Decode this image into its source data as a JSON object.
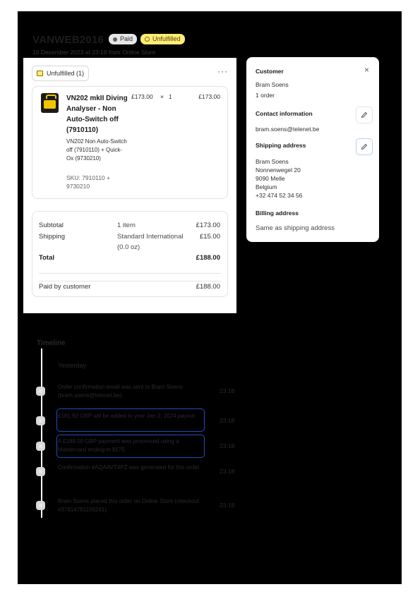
{
  "order": {
    "title": "VANWEB2016",
    "paid_label": "Paid",
    "unfulfilled_label": "Unfulfilled",
    "date_line": "10 December 2023 at 23:18 from Online Store"
  },
  "fulfillment": {
    "status_label": "Unfulfilled (1)",
    "more_label": "···",
    "item": {
      "name": "VN202 mkII Diving Analyser - Non Auto-Switch off (7910110)",
      "variant": "VN202 Non Auto-Switch off (7910110) + Quick-Ox (9730210)",
      "sku": "SKU: 7910110 + 9730210",
      "price": "£173.00",
      "times": "×",
      "qty": "1",
      "total": "£173.00"
    }
  },
  "summary": {
    "subtotal_label": "Subtotal",
    "subtotal_desc": "1 item",
    "subtotal_value": "£173.00",
    "shipping_label": "Shipping",
    "shipping_desc": "Standard International (0.0 oz)",
    "shipping_value": "£15.00",
    "total_label": "Total",
    "total_value": "£188.00",
    "paid_label": "Paid by customer",
    "paid_value": "£188.00"
  },
  "customer": {
    "heading": "Customer",
    "close_label": "×",
    "name": "Bram Soens",
    "orders": "1 order",
    "contact_heading": "Contact information",
    "email": "bram.soens@telenet.be",
    "shipping_heading": "Shipping address",
    "address": [
      "Bram Soens",
      "Nonnenwegel 20",
      "9090 Melle",
      "Belgium",
      "+32 474 52 34 56"
    ],
    "billing_heading": "Billing address",
    "billing_text": "Same as shipping address"
  },
  "timeline": {
    "title": "Timeline",
    "subheading": "Yesterday",
    "events": [
      {
        "text": "Order confirmation email was sent to Bram Soens (bram.soens@telenet.be).",
        "time": "23:18"
      },
      {
        "text": "£181.92 GBP will be added to your Jan 2, 2024 payout.",
        "time": "23:18"
      },
      {
        "text": "A £188.00 GBP payment was processed using a Mastercard ending in 8175.",
        "time": "23:18"
      },
      {
        "text": "Confirmation #AQAAVT4PZ was generated for this order.",
        "time": "23:18"
      },
      {
        "text": "Bram Soens placed this order on Online Store (checkout #37814781106241).",
        "time": "23:18"
      }
    ]
  }
}
